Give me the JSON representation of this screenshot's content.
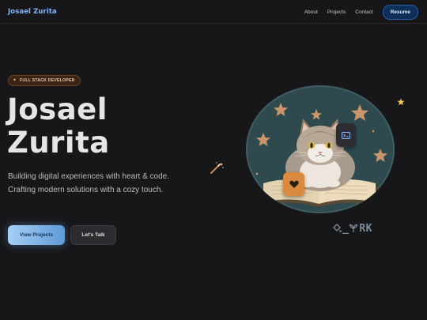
{
  "nav": {
    "brand": "Josael Zurita",
    "links": [
      "About",
      "Projects",
      "Contact"
    ],
    "resume_label": "Resume"
  },
  "hero": {
    "badge": "FULL STACK DEVELOPER",
    "title_line1": "Josael",
    "title_line2": "Zurita",
    "description": "Building digital experiences with heart & code. Crafting modern solutions with a cozy touch.",
    "primary_cta": "View Projects",
    "secondary_cta": "Let's Talk"
  },
  "illustration": {
    "watermark": "RK"
  },
  "colors": {
    "background": "#17171a",
    "brand": "#7eb3ff",
    "badge_bg": "#3a2416",
    "circle_bg": "#2f4a4f",
    "accent_orange": "#d98a3f",
    "star_gold": "#f2c94c"
  },
  "icons": [
    "sparkle-icon",
    "magic-wand-icon",
    "star-icon",
    "terminal-icon",
    "heart-icon",
    "paint-bucket-icon",
    "leaf-icon"
  ]
}
